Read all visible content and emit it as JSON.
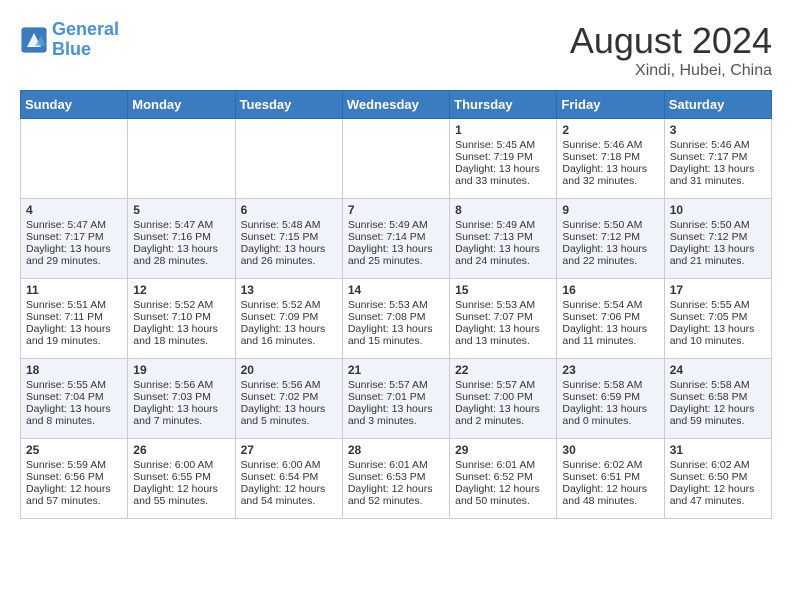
{
  "logo": {
    "text_general": "General",
    "text_blue": "Blue"
  },
  "title": {
    "month_year": "August 2024",
    "location": "Xindi, Hubei, China"
  },
  "days_of_week": [
    "Sunday",
    "Monday",
    "Tuesday",
    "Wednesday",
    "Thursday",
    "Friday",
    "Saturday"
  ],
  "weeks": [
    [
      {
        "day": "",
        "info": ""
      },
      {
        "day": "",
        "info": ""
      },
      {
        "day": "",
        "info": ""
      },
      {
        "day": "",
        "info": ""
      },
      {
        "day": "1",
        "info": "Sunrise: 5:45 AM\nSunset: 7:19 PM\nDaylight: 13 hours and 33 minutes."
      },
      {
        "day": "2",
        "info": "Sunrise: 5:46 AM\nSunset: 7:18 PM\nDaylight: 13 hours and 32 minutes."
      },
      {
        "day": "3",
        "info": "Sunrise: 5:46 AM\nSunset: 7:17 PM\nDaylight: 13 hours and 31 minutes."
      }
    ],
    [
      {
        "day": "4",
        "info": "Sunrise: 5:47 AM\nSunset: 7:17 PM\nDaylight: 13 hours and 29 minutes."
      },
      {
        "day": "5",
        "info": "Sunrise: 5:47 AM\nSunset: 7:16 PM\nDaylight: 13 hours and 28 minutes."
      },
      {
        "day": "6",
        "info": "Sunrise: 5:48 AM\nSunset: 7:15 PM\nDaylight: 13 hours and 26 minutes."
      },
      {
        "day": "7",
        "info": "Sunrise: 5:49 AM\nSunset: 7:14 PM\nDaylight: 13 hours and 25 minutes."
      },
      {
        "day": "8",
        "info": "Sunrise: 5:49 AM\nSunset: 7:13 PM\nDaylight: 13 hours and 24 minutes."
      },
      {
        "day": "9",
        "info": "Sunrise: 5:50 AM\nSunset: 7:12 PM\nDaylight: 13 hours and 22 minutes."
      },
      {
        "day": "10",
        "info": "Sunrise: 5:50 AM\nSunset: 7:12 PM\nDaylight: 13 hours and 21 minutes."
      }
    ],
    [
      {
        "day": "11",
        "info": "Sunrise: 5:51 AM\nSunset: 7:11 PM\nDaylight: 13 hours and 19 minutes."
      },
      {
        "day": "12",
        "info": "Sunrise: 5:52 AM\nSunset: 7:10 PM\nDaylight: 13 hours and 18 minutes."
      },
      {
        "day": "13",
        "info": "Sunrise: 5:52 AM\nSunset: 7:09 PM\nDaylight: 13 hours and 16 minutes."
      },
      {
        "day": "14",
        "info": "Sunrise: 5:53 AM\nSunset: 7:08 PM\nDaylight: 13 hours and 15 minutes."
      },
      {
        "day": "15",
        "info": "Sunrise: 5:53 AM\nSunset: 7:07 PM\nDaylight: 13 hours and 13 minutes."
      },
      {
        "day": "16",
        "info": "Sunrise: 5:54 AM\nSunset: 7:06 PM\nDaylight: 13 hours and 11 minutes."
      },
      {
        "day": "17",
        "info": "Sunrise: 5:55 AM\nSunset: 7:05 PM\nDaylight: 13 hours and 10 minutes."
      }
    ],
    [
      {
        "day": "18",
        "info": "Sunrise: 5:55 AM\nSunset: 7:04 PM\nDaylight: 13 hours and 8 minutes."
      },
      {
        "day": "19",
        "info": "Sunrise: 5:56 AM\nSunset: 7:03 PM\nDaylight: 13 hours and 7 minutes."
      },
      {
        "day": "20",
        "info": "Sunrise: 5:56 AM\nSunset: 7:02 PM\nDaylight: 13 hours and 5 minutes."
      },
      {
        "day": "21",
        "info": "Sunrise: 5:57 AM\nSunset: 7:01 PM\nDaylight: 13 hours and 3 minutes."
      },
      {
        "day": "22",
        "info": "Sunrise: 5:57 AM\nSunset: 7:00 PM\nDaylight: 13 hours and 2 minutes."
      },
      {
        "day": "23",
        "info": "Sunrise: 5:58 AM\nSunset: 6:59 PM\nDaylight: 13 hours and 0 minutes."
      },
      {
        "day": "24",
        "info": "Sunrise: 5:58 AM\nSunset: 6:58 PM\nDaylight: 12 hours and 59 minutes."
      }
    ],
    [
      {
        "day": "25",
        "info": "Sunrise: 5:59 AM\nSunset: 6:56 PM\nDaylight: 12 hours and 57 minutes."
      },
      {
        "day": "26",
        "info": "Sunrise: 6:00 AM\nSunset: 6:55 PM\nDaylight: 12 hours and 55 minutes."
      },
      {
        "day": "27",
        "info": "Sunrise: 6:00 AM\nSunset: 6:54 PM\nDaylight: 12 hours and 54 minutes."
      },
      {
        "day": "28",
        "info": "Sunrise: 6:01 AM\nSunset: 6:53 PM\nDaylight: 12 hours and 52 minutes."
      },
      {
        "day": "29",
        "info": "Sunrise: 6:01 AM\nSunset: 6:52 PM\nDaylight: 12 hours and 50 minutes."
      },
      {
        "day": "30",
        "info": "Sunrise: 6:02 AM\nSunset: 6:51 PM\nDaylight: 12 hours and 48 minutes."
      },
      {
        "day": "31",
        "info": "Sunrise: 6:02 AM\nSunset: 6:50 PM\nDaylight: 12 hours and 47 minutes."
      }
    ]
  ]
}
